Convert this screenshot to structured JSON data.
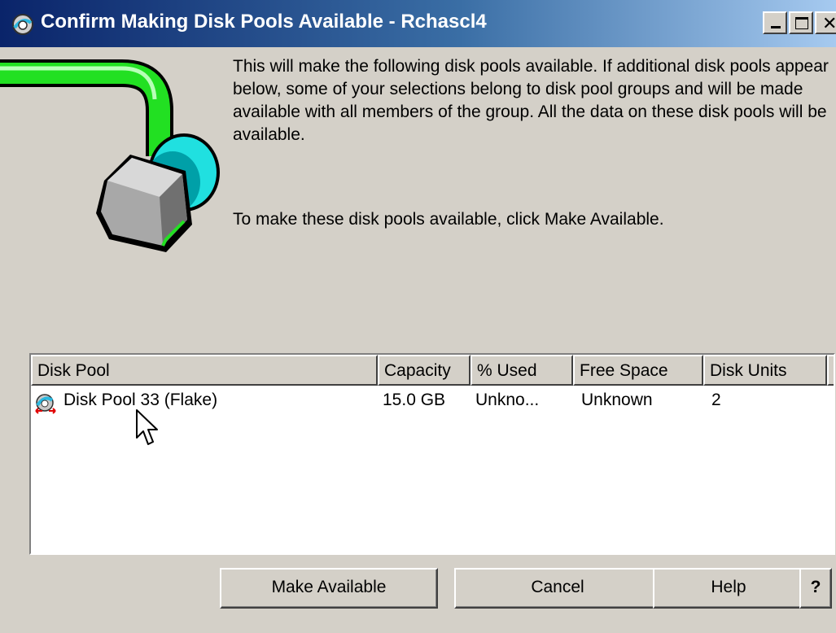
{
  "window": {
    "title": "Confirm Making Disk Pools Available - Rchascl4"
  },
  "message": {
    "paragraph1": "This will make the following disk pools available.  If additional disk pools appear below, some of your selections belong to disk pool groups and will be made available with all members of the group.  All the data on these disk pools will be available.",
    "paragraph2": "To make these disk pools available, click Make Available."
  },
  "table": {
    "columns": [
      "Disk Pool",
      "Capacity",
      "% Used",
      "Free Space",
      "Disk Units"
    ],
    "rows": [
      {
        "name": "Disk Pool 33 (Flake)",
        "capacity": "15.0 GB",
        "used": "Unkno...",
        "free": "Unknown",
        "units": "2"
      }
    ]
  },
  "buttons": {
    "make_available": "Make Available",
    "cancel": "Cancel",
    "help": "Help",
    "context_help": "?"
  },
  "icons": {
    "title": "disk-pool-app-icon",
    "illustration": "disk-pipe-illustration",
    "row": "disk-pool-icon",
    "cursor": "mouse-pointer-icon"
  },
  "colors": {
    "title_bar_start": "#0a246a",
    "title_bar_end": "#a6caf0",
    "dialog_bg": "#d4d0c8",
    "pipe_green": "#22e022",
    "cylinder_cyan": "#20e0e0",
    "disk_gray": "#a8a8a8"
  }
}
